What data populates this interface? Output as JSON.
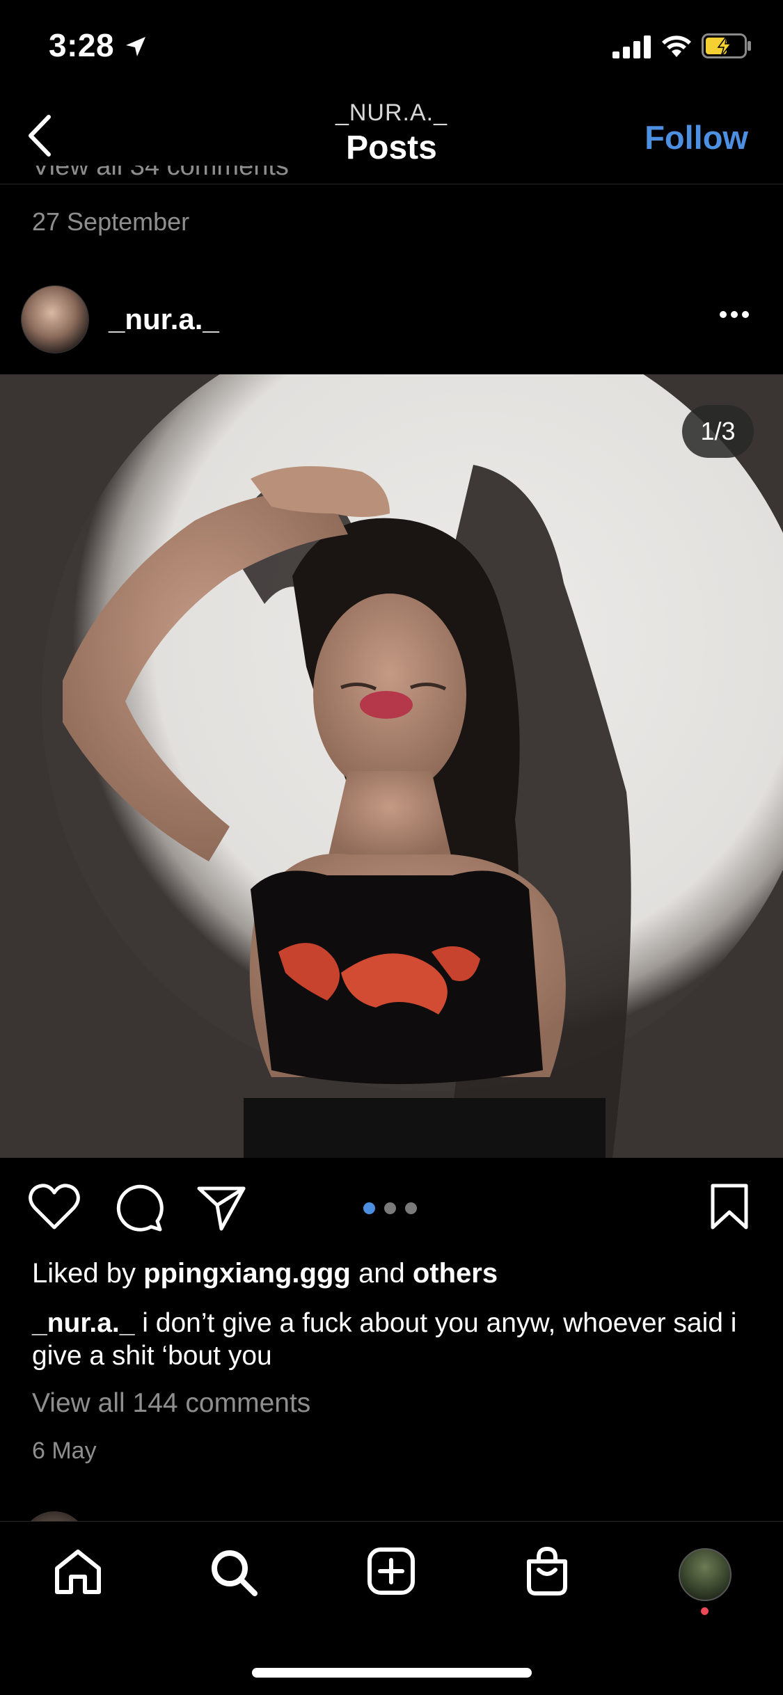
{
  "status_bar": {
    "time": "3:28"
  },
  "header": {
    "username": "_NUR.A._",
    "title": "Posts",
    "follow_label": "Follow"
  },
  "previous_post": {
    "cutoff_text": "View all 34 comments",
    "date": "27 September"
  },
  "post": {
    "username": "_nur.a._",
    "photo_counter": "1/3",
    "carousel": {
      "total": 3,
      "active_index": 0
    },
    "likes": {
      "prefix": "Liked by",
      "user": "ppingxiang.ggg",
      "joiner": "and",
      "others": "others"
    },
    "caption": {
      "username": "_nur.a._",
      "text": "i don’t give a fuck about you anyw, whoever said i give a shit ‘bout you"
    },
    "view_comments": "View all 144 comments",
    "date": "6 May"
  },
  "tab_bar": {
    "items": [
      "home",
      "search",
      "create",
      "shop",
      "profile"
    ]
  },
  "colors": {
    "accent": "#4d8fe0",
    "muted_text": "#8e8e8e",
    "notification": "#ed4956",
    "battery_charging": "#f5d033"
  }
}
